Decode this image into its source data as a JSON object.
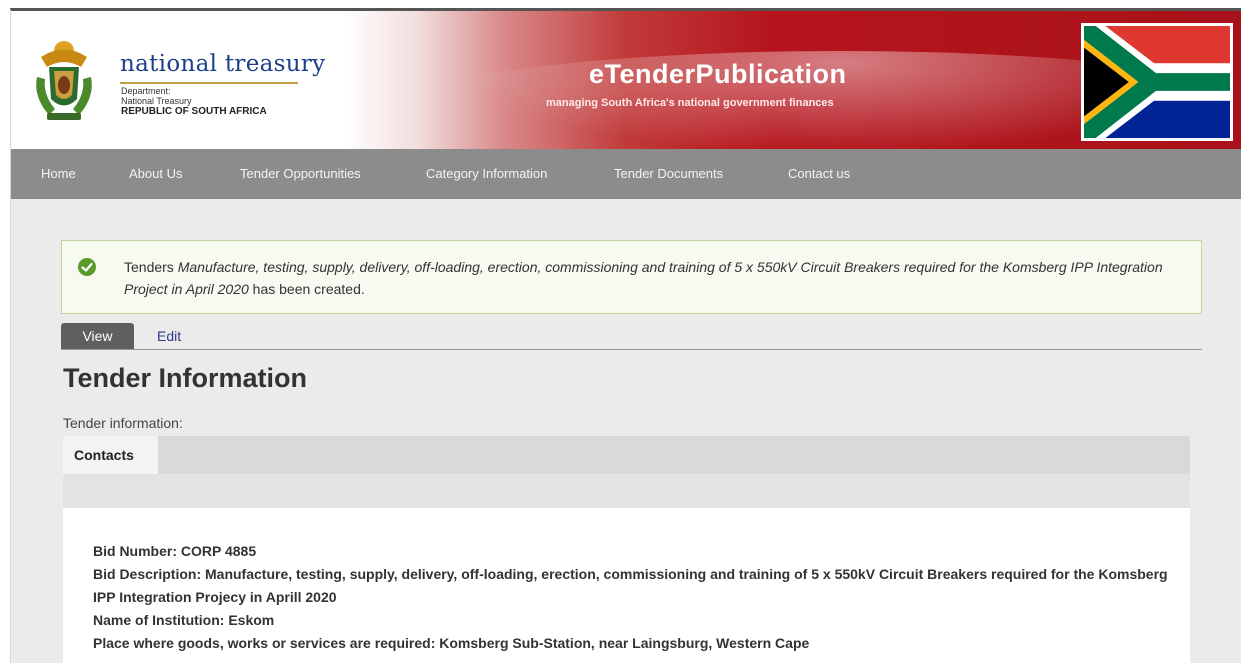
{
  "header": {
    "brand_title": "national treasury",
    "brand_sub1": "Department:",
    "brand_sub2": "National Treasury",
    "brand_sub3": "REPUBLIC OF SOUTH AFRICA",
    "site_title": "eTenderPublication",
    "site_subtitle": "managing South Africa's national government finances"
  },
  "nav": {
    "items": [
      "Home",
      "About Us",
      "Tender Opportunities",
      "Category Information",
      "Tender Documents",
      "Contact us"
    ]
  },
  "message": {
    "prefix": "Tenders ",
    "title": "Manufacture, testing, supply, delivery, off-loading, erection, commissioning and training of 5 x 550kV Circuit Breakers required for the Komsberg IPP Integration Project in April 2020",
    "suffix": " has been created."
  },
  "tabs": {
    "view": "View",
    "edit": "Edit"
  },
  "page_title": "Tender Information",
  "info_label": "Tender information:",
  "panel": {
    "tab_contacts": "Contacts",
    "details": [
      "Bid Number: CORP 4885",
      "Bid Description: Manufacture, testing, supply, delivery, off-loading, erection, commissioning and training of 5 x 550kV Circuit Breakers required for the Komsberg IPP Integration Projecy in Aprill 2020",
      "Name of Institution: Eskom",
      "Place where goods, works or services are required: Komsberg Sub-Station, near Laingsburg, Western Cape"
    ]
  },
  "colors": {
    "header_red": "#b0141b",
    "nav_gray": "#8c8c8c",
    "success_border": "#bfd59a",
    "success_icon": "#5a9a2a",
    "link_blue": "#2a3a8a"
  }
}
